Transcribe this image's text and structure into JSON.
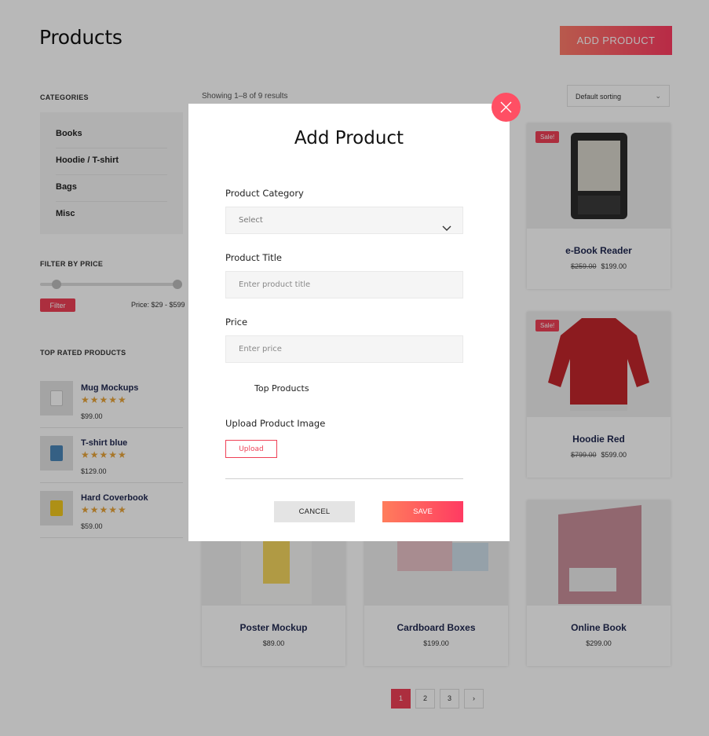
{
  "page": {
    "title": "Products",
    "add_button": "ADD PRODUCT"
  },
  "sidebar": {
    "categories_heading": "CATEGORIES",
    "categories": [
      "Books",
      "Hoodie / T-shirt",
      "Bags",
      "Misc"
    ],
    "filter_heading": "FILTER BY PRICE",
    "filter_button": "Filter",
    "price_range": "Price: $29 - $599",
    "top_rated_heading": "TOP RATED PRODUCTS",
    "top_rated": [
      {
        "name": "Mug Mockups",
        "stars": "★★★★★",
        "price": "$99.00",
        "color": "#ffffff"
      },
      {
        "name": "T-shirt blue",
        "stars": "★★★★★",
        "price": "$129.00",
        "color": "#4a86b8"
      },
      {
        "name": "Hard Coverbook",
        "stars": "★★★★★",
        "price": "$59.00",
        "color": "#f2c81f"
      }
    ]
  },
  "listing": {
    "showing": "Showing 1–8 of 9 results",
    "sort": "Default sorting",
    "products": [
      {
        "name": "e-Book Reader",
        "old_price": "$259.00",
        "price": "$199.00",
        "sale": "Sale!"
      },
      {
        "name": "Hoodie Red",
        "old_price": "$799.00",
        "price": "$599.00",
        "sale": "Sale!"
      },
      {
        "name": "Poster Mockup",
        "price": "$89.00"
      },
      {
        "name": "Cardboard Boxes",
        "price": "$199.00"
      },
      {
        "name": "Online Book",
        "price": "$299.00"
      }
    ],
    "pages": [
      "1",
      "2",
      "3",
      "›"
    ]
  },
  "modal": {
    "title": "Add Product",
    "category_label": "Product Category",
    "category_value": "Select",
    "title_label": "Product Title",
    "title_placeholder": "Enter product title",
    "price_label": "Price",
    "price_placeholder": "Enter price",
    "top_products_label": "Top Products",
    "image_label": "Upload Product Image",
    "upload_button": "Upload",
    "cancel_button": "CANCEL",
    "save_button": "SAVE"
  },
  "colors": {
    "accent": "#ef4156",
    "star": "#e8a43a",
    "close": "#ff4f64"
  }
}
